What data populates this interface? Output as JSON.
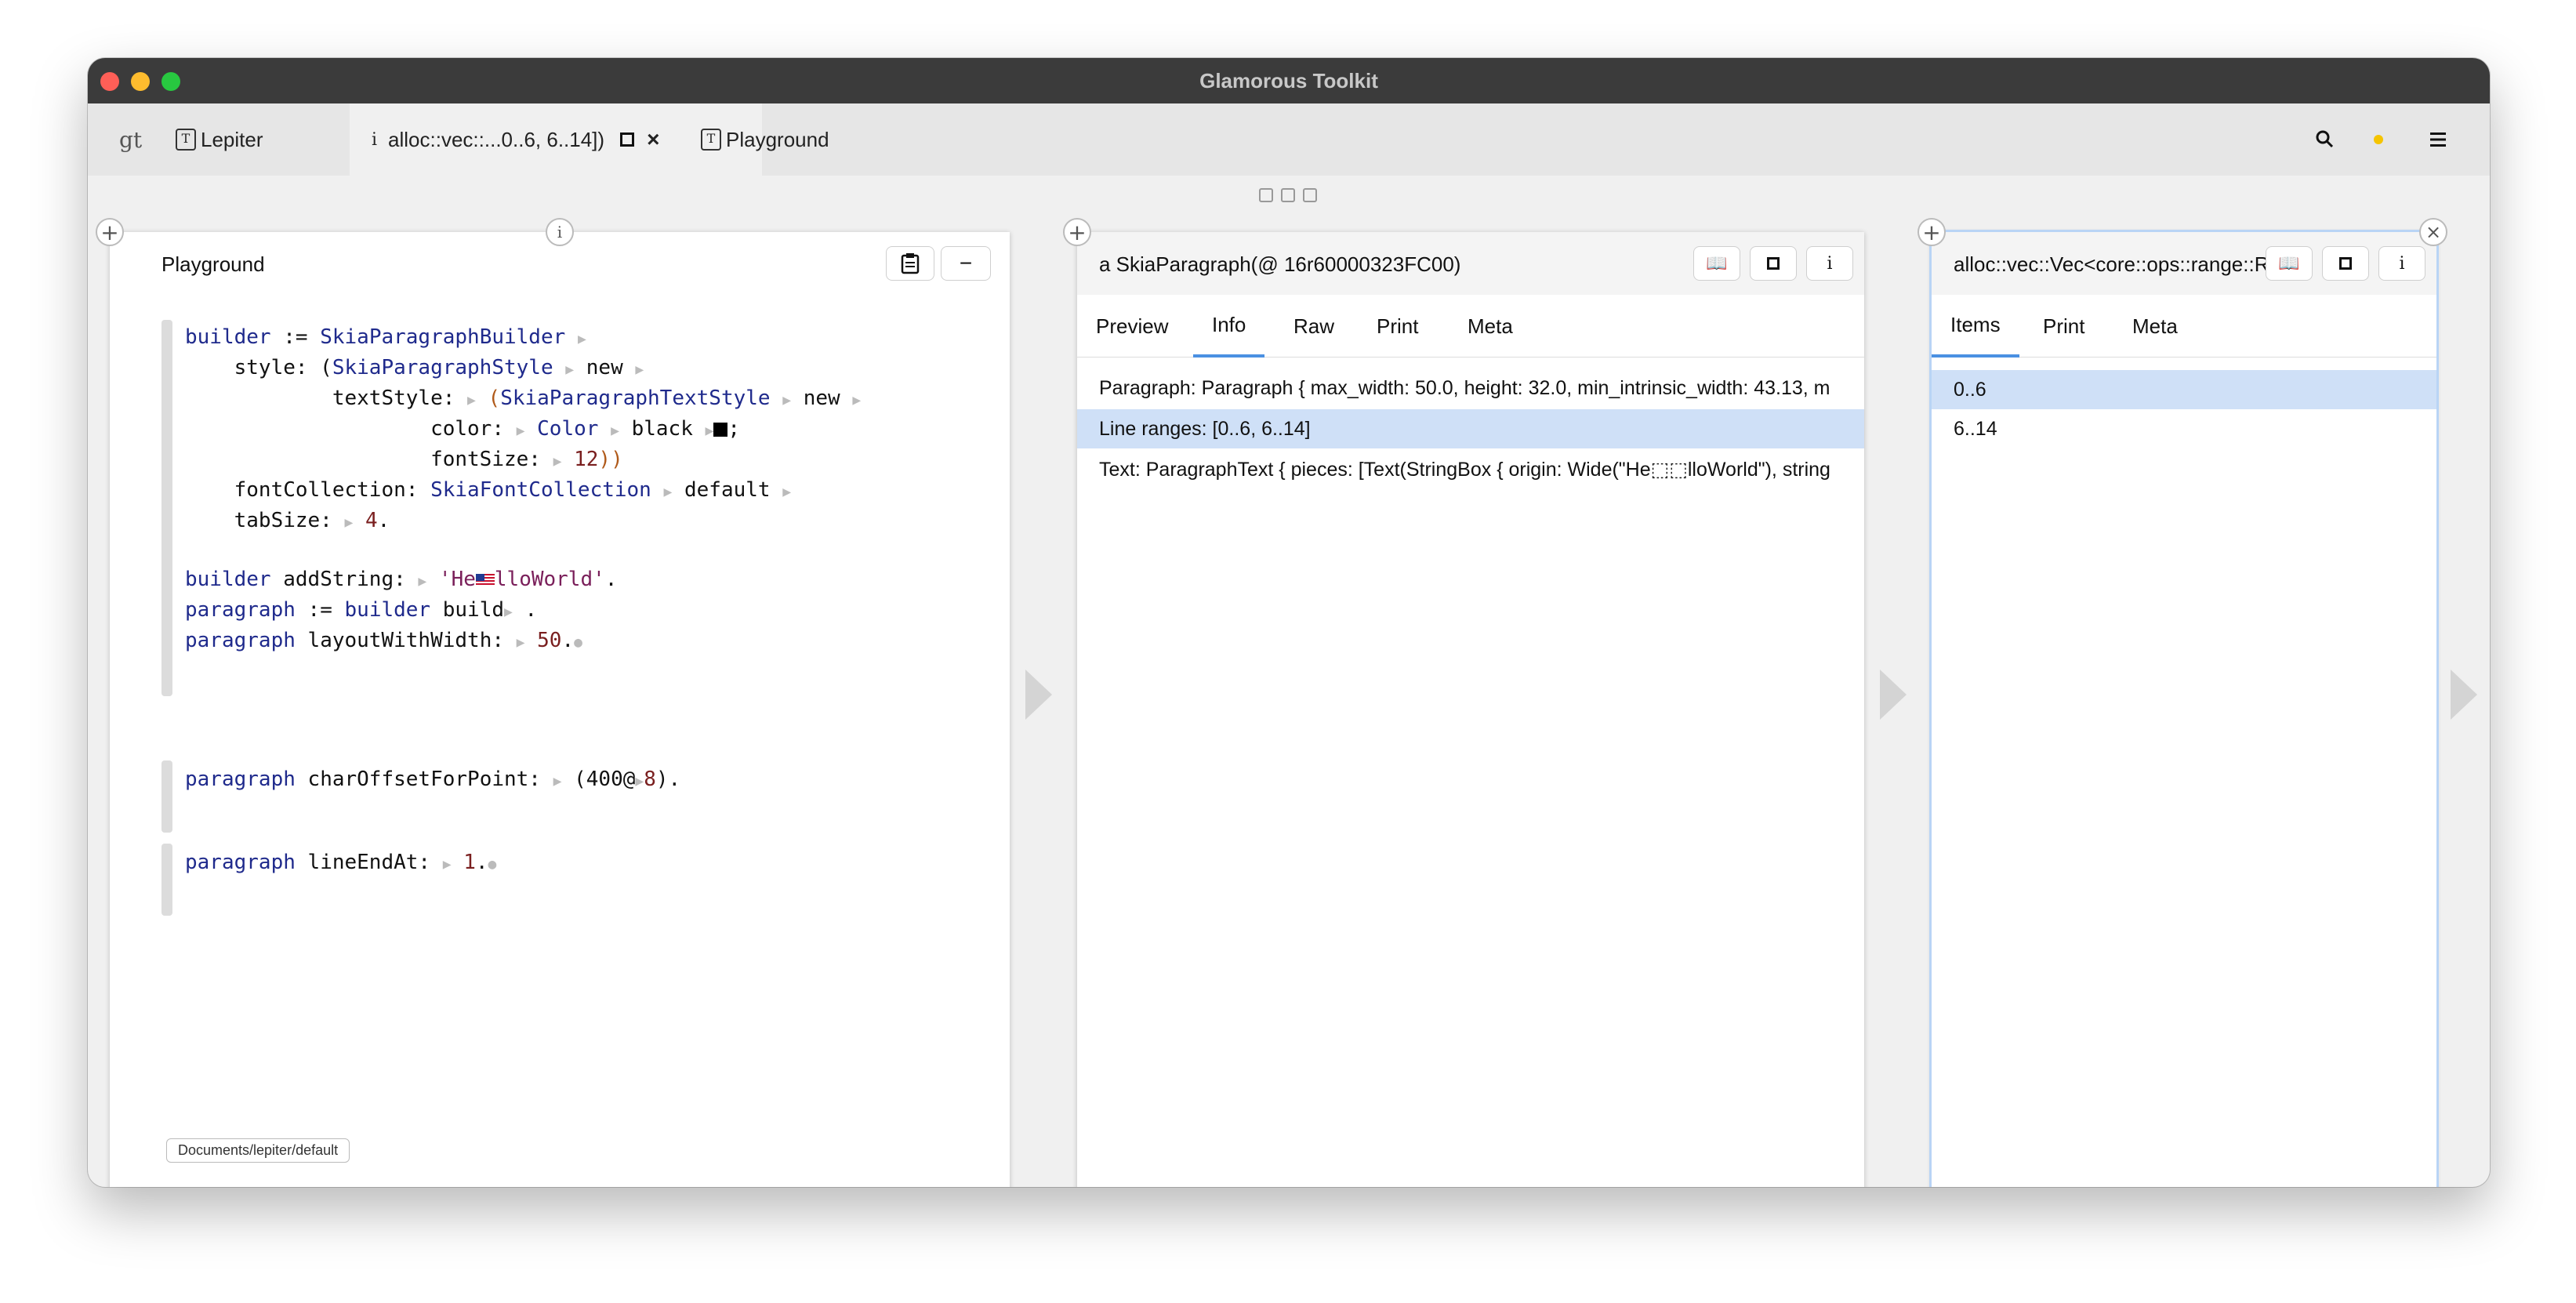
{
  "window": {
    "title": "Glamorous Toolkit"
  },
  "tabs": [
    {
      "label": "gt"
    },
    {
      "label": "Lepiter"
    },
    {
      "label": "alloc::vec::...0..6, 6..14])"
    },
    {
      "label": "Playground"
    }
  ],
  "pane1": {
    "title": "Playground",
    "path": "Documents/lepiter/default",
    "code": {
      "l1a": "builder",
      "l1b": " := ",
      "l1c": "SkiaParagraphBuilder",
      "l2a": "    style: (",
      "l2b": "SkiaParagraphStyle",
      "l2c": "new",
      "l3a": "            textStyle: ",
      "l3b": "(",
      "l3c": "SkiaParagraphTextStyle",
      "l3d": "new",
      "l4a": "                    color: ",
      "l4b": "Color",
      "l4c": "black",
      "l4d": ";",
      "l5a": "                    fontSize: ",
      "l5b": "12",
      "l5c": "))",
      "l6a": "    fontCollection: ",
      "l6b": "SkiaFontCollection",
      "l6c": "default",
      "l7a": "    tabSize: ",
      "l7b": "4",
      "l7c": ".",
      "l8a": "builder",
      "l8b": " addString: ",
      "l8c": "'He",
      "l8d": "lloWorld'",
      "l8e": ".",
      "l9a": "paragraph",
      "l9b": " := ",
      "l9c": "builder",
      "l9d": " build",
      "l9e": " .",
      "l10a": "paragraph",
      "l10b": " layoutWithWidth: ",
      "l10c": "50",
      "l10d": ".",
      "l11a": "paragraph",
      "l11b": " charOffsetForPoint: ",
      "l11c": "(400@",
      "l11d": "8",
      "l11e": ").",
      "l12a": "paragraph",
      "l12b": " lineEndAt: ",
      "l12c": "1",
      "l12d": "."
    }
  },
  "pane2": {
    "title": "a SkiaParagraph(@ 16r60000323FC00)",
    "tabs": [
      "Preview",
      "Info",
      "Raw",
      "Print",
      "Meta"
    ],
    "rows": [
      "Paragraph: Paragraph { max_width: 50.0, height: 32.0, min_intrinsic_width: 43.13, m",
      "Line ranges: [0..6, 6..14]",
      "Text: ParagraphText { pieces: [Text(StringBox { origin: Wide(\"He⬚⬚lloWorld\"), string"
    ]
  },
  "pane3": {
    "title": "alloc::vec::Vec<core::ops::range::Ra",
    "tabs": [
      "Items",
      "Print",
      "Meta"
    ],
    "rows": [
      "0..6",
      "6..14"
    ]
  },
  "icons": {
    "search": "search-icon",
    "status": "status-dot-icon",
    "menu": "hamburger-menu-icon"
  },
  "colors": {
    "accent": "#4a90e2",
    "selection": "#cfe0f7",
    "status_dot": "#f5c400"
  }
}
